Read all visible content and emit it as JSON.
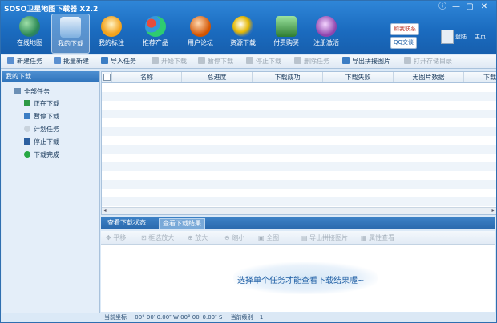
{
  "window": {
    "title": "SOSO卫星地图下载器 X2.2",
    "controls": [
      "ⓘ",
      "—",
      "▢",
      "✕"
    ]
  },
  "ribbon": {
    "items": [
      {
        "label": "在线地图",
        "icon": "globe-icon",
        "color": "#3a9d52"
      },
      {
        "label": "我的下载",
        "icon": "download-icon",
        "color": "#4a86c5"
      },
      {
        "label": "我的标注",
        "icon": "map-pin-icon",
        "color": "#f3a21c"
      },
      {
        "label": "推荐产品",
        "icon": "products-icon",
        "color": "#e74c3c"
      },
      {
        "label": "用户论坛",
        "icon": "users-icon",
        "color": "#d35400"
      },
      {
        "label": "资源下载",
        "icon": "resource-download-icon",
        "color": "#e6b800"
      },
      {
        "label": "付费购买",
        "icon": "cart-icon",
        "color": "#2e7d32"
      },
      {
        "label": "注册激活",
        "icon": "register-icon",
        "color": "#8e44ad"
      }
    ],
    "help_badge": "和我联系",
    "qq_badge": "QQ交谈",
    "user_label": "登陆",
    "home_label": "主页"
  },
  "toolbar": {
    "items": [
      {
        "label": "新建任务",
        "disabled": false
      },
      {
        "label": "批量新建",
        "disabled": false
      },
      {
        "label": "导入任务",
        "disabled": false
      },
      {
        "label": "开始下载",
        "disabled": true
      },
      {
        "label": "暂停下载",
        "disabled": true
      },
      {
        "label": "停止下载",
        "disabled": true
      },
      {
        "label": "删除任务",
        "disabled": true
      },
      {
        "label": "导出拼接图片",
        "disabled": false
      },
      {
        "label": "打开存储目录",
        "disabled": true
      }
    ]
  },
  "sidebar": {
    "header": "我的下载",
    "items": [
      {
        "label": "全部任务",
        "icon": "all-tasks-icon",
        "level": 0
      },
      {
        "label": "正在下载",
        "icon": "play-icon",
        "level": 1
      },
      {
        "label": "暂停下载",
        "icon": "pause-icon",
        "level": 1
      },
      {
        "label": "计划任务",
        "icon": "clock-icon",
        "level": 1
      },
      {
        "label": "停止下载",
        "icon": "stop-icon",
        "level": 1
      },
      {
        "label": "下载完成",
        "icon": "check-icon",
        "level": 1
      }
    ]
  },
  "grid": {
    "columns": [
      "名称",
      "总进度",
      "下载成功",
      "下载失败",
      "无图片数据",
      "下载"
    ]
  },
  "tabs": {
    "items": [
      "查看下载状态",
      "查看下载结果"
    ],
    "active": 1
  },
  "result_toolbar": {
    "items": [
      "平移",
      "框选放大",
      "放大",
      "缩小",
      "全图",
      "导出拼接图片",
      "属性查看"
    ]
  },
  "result": {
    "hint": "选择单个任务才能查看下载结果喔~"
  },
  "status": {
    "coords_label": "当前坐标",
    "coords_value": "00° 00′ 0.00″ W 00° 00′ 0.00″ S",
    "level_label": "当前级别",
    "level_value": "1"
  }
}
